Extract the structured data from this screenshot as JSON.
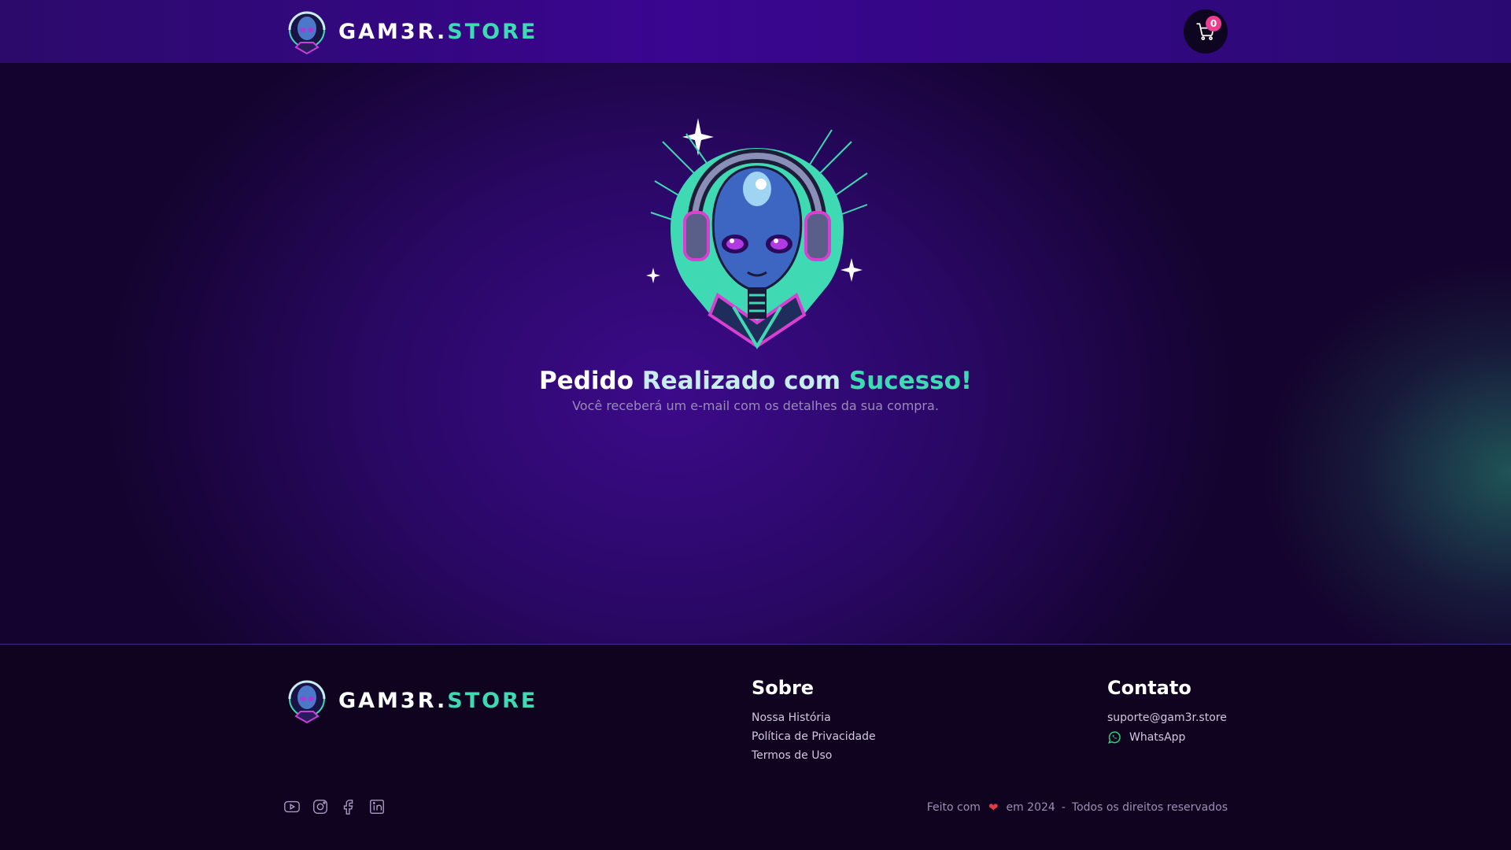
{
  "header": {
    "brand_part1": "GAM3R.",
    "brand_part2": "STORE",
    "cart_count": "0",
    "cart_icon": "cart-icon"
  },
  "main": {
    "title_word1": "Pedido",
    "title_word2": "Realizado com",
    "title_word3": "Sucesso!",
    "subtitle": "Você receberá um e-mail com os detalhes da sua compra.",
    "image": "alien-headset-mascot"
  },
  "footer": {
    "brand_part1": "GAM3R.",
    "brand_part2": "STORE",
    "about_title": "Sobre",
    "about_links": [
      "Nossa História",
      "Política de Privacidade",
      "Termos de Uso"
    ],
    "contact_title": "Contato",
    "email": "suporte@gam3r.store",
    "whatsapp": "WhatsApp",
    "social_icons": [
      "youtube-icon",
      "instagram-icon",
      "facebook-icon",
      "linkedin-icon"
    ],
    "made_with": "Feito com",
    "year_text": "em 2024",
    "separator": "-",
    "rights": "Todos os direitos reservados"
  },
  "colors": {
    "accent_teal": "#3fd9b4",
    "badge_pink": "#ec3e8e",
    "header_purple": "#3a0590",
    "footer_bg": "#100320"
  }
}
